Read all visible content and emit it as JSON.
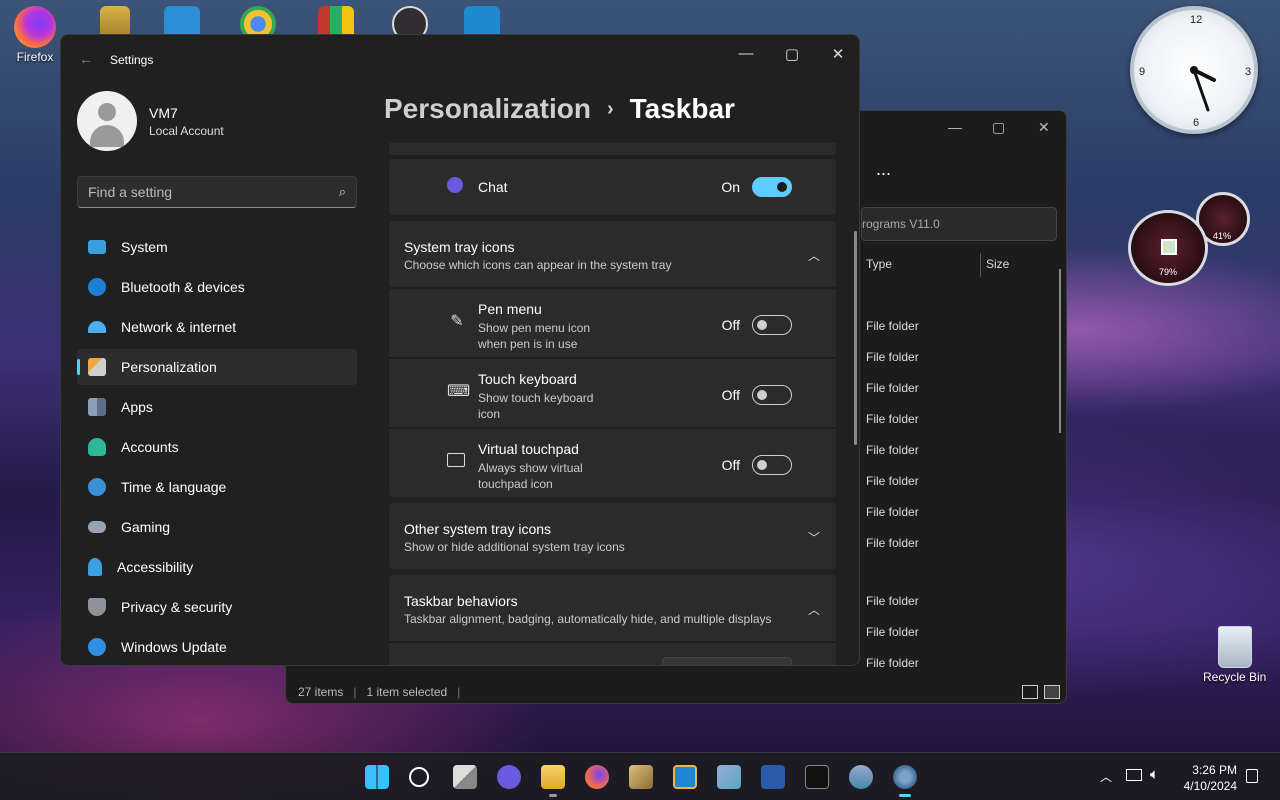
{
  "desktop": {
    "firefox_label": "Firefox",
    "recycle_label": "Recycle Bin",
    "clock": {
      "n12": "12",
      "n3": "3",
      "n6": "6",
      "n9": "9"
    },
    "meter": {
      "cpu": "79%",
      "mem": "41%"
    }
  },
  "explorer": {
    "address": "rograms V11.0",
    "col_type": "Type",
    "col_size": "Size",
    "rows": [
      "File folder",
      "File folder",
      "File folder",
      "File folder",
      "File folder",
      "File folder",
      "File folder",
      "File folder",
      "File folder",
      "File folder",
      "File folder"
    ],
    "status_items": "27 items",
    "status_selected": "1 item selected",
    "more": "..."
  },
  "settings": {
    "title": "Settings",
    "profile": {
      "name": "VM7",
      "account": "Local Account"
    },
    "search_placeholder": "Find a setting",
    "nav": [
      {
        "label": "System"
      },
      {
        "label": "Bluetooth & devices"
      },
      {
        "label": "Network & internet"
      },
      {
        "label": "Personalization"
      },
      {
        "label": "Apps"
      },
      {
        "label": "Accounts"
      },
      {
        "label": "Time & language"
      },
      {
        "label": "Gaming"
      },
      {
        "label": "Accessibility"
      },
      {
        "label": "Privacy & security"
      },
      {
        "label": "Windows Update"
      }
    ],
    "breadcrumb": {
      "parent": "Personalization",
      "current": "Taskbar"
    },
    "chat": {
      "label": "Chat",
      "state": "On"
    },
    "tray_section": {
      "title": "System tray icons",
      "subtitle": "Choose which icons can appear in the system tray"
    },
    "tray_items": [
      {
        "title": "Pen menu",
        "subtitle": "Show pen menu icon when pen is in use",
        "state": "Off"
      },
      {
        "title": "Touch keyboard",
        "subtitle": "Show touch keyboard icon",
        "state": "Off"
      },
      {
        "title": "Virtual touchpad",
        "subtitle": "Always show virtual touchpad icon",
        "state": "Off"
      }
    ],
    "other_tray": {
      "title": "Other system tray icons",
      "subtitle": "Show or hide additional system tray icons"
    },
    "behaviors": {
      "title": "Taskbar behaviors",
      "subtitle": "Taskbar alignment, badging, automatically hide, and multiple displays"
    }
  },
  "taskbar": {
    "time": "3:26 PM",
    "date": "4/10/2024"
  },
  "colors": {
    "accent": "#60cdff",
    "window_bg": "#202020",
    "card_bg": "#2b2b2b"
  }
}
